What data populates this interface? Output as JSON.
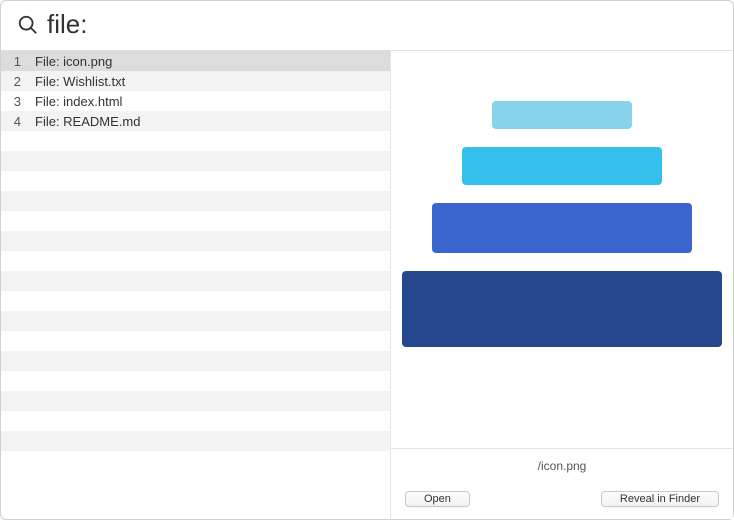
{
  "search": {
    "query": "file:",
    "placeholder": ""
  },
  "results": [
    {
      "index": "1",
      "label": "File: icon.png",
      "selected": true
    },
    {
      "index": "2",
      "label": "File: Wishlist.txt",
      "selected": false
    },
    {
      "index": "3",
      "label": "File: index.html",
      "selected": false
    },
    {
      "index": "4",
      "label": "File: README.md",
      "selected": false
    }
  ],
  "list_total_rows": 21,
  "preview": {
    "path": "/icon.png",
    "icon_bars": [
      {
        "color": "#88d3ec"
      },
      {
        "color": "#34c0ec"
      },
      {
        "color": "#3b66d0"
      },
      {
        "color": "#25478e"
      }
    ]
  },
  "buttons": {
    "open": "Open",
    "reveal": "Reveal in Finder"
  }
}
